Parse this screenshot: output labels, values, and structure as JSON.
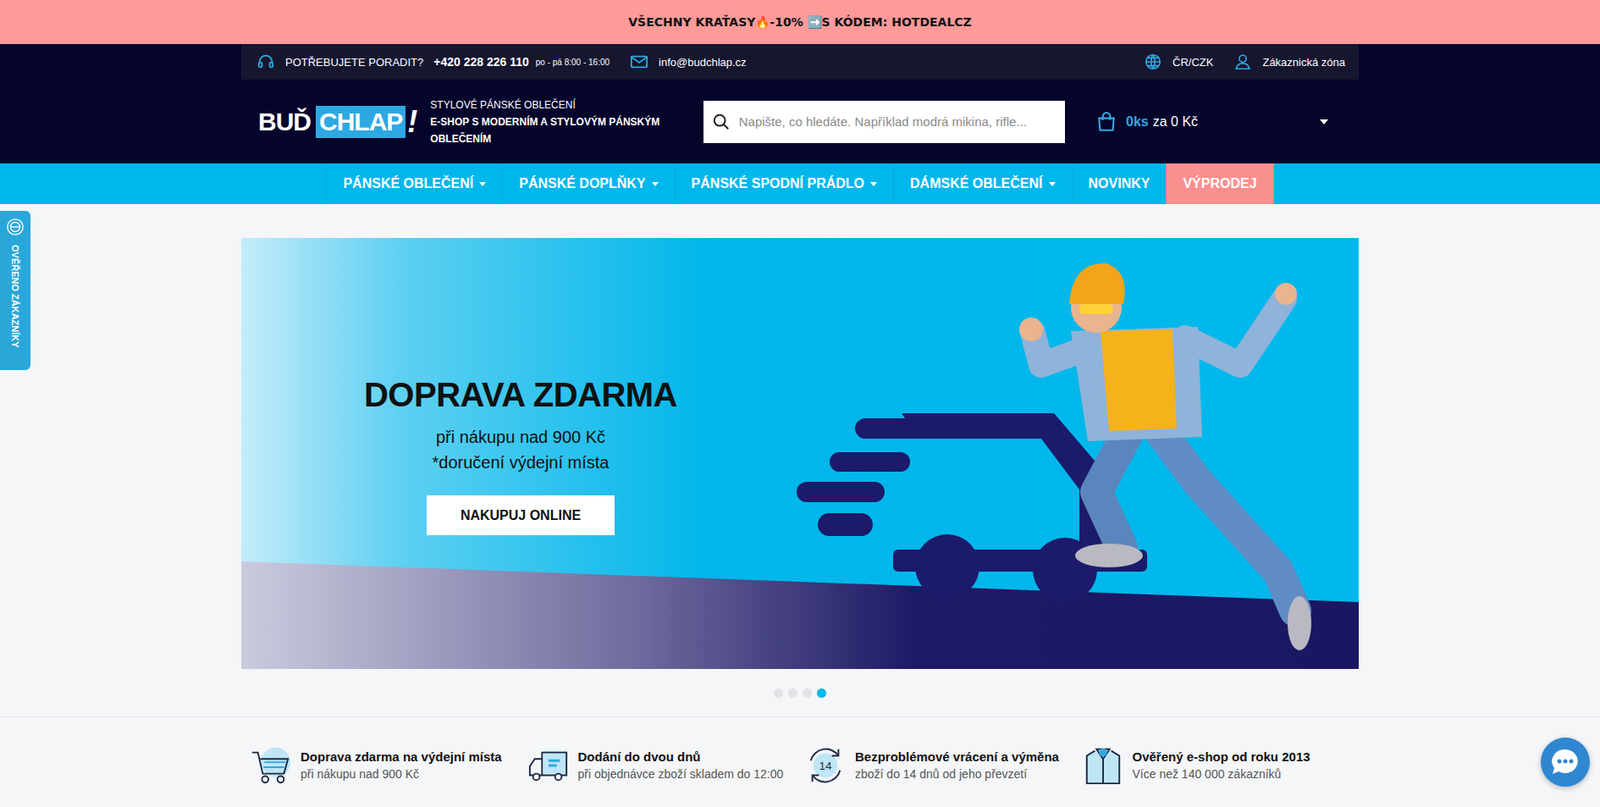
{
  "promo_bar": {
    "text": "VŠECHNY KRAŤASY🔥-10% ➡️S KÓDEM: HOTDEALCZ"
  },
  "top_bar": {
    "help_label": "POTŘEBUJETE PORADIT?",
    "phone": "+420 228 226 110",
    "hours": "po - pá 8:00 - 16:00",
    "email": "info@budchlap.cz",
    "region": "ČR/CZK",
    "account": "Zákaznická zóna"
  },
  "header": {
    "logo": [
      "BUĎ",
      "CHLAP",
      "!"
    ],
    "tagline": [
      "STYLOVÉ PÁNSKÉ OBLEČENÍ",
      "E-SHOP S MODERNÍM A STYLOVÝM PÁNSKÝM OBLEČENÍM"
    ],
    "search": {
      "placeholder": "Napište, co hledáte. Například modrá mikina, rifle..."
    },
    "cart": {
      "count": "0ks",
      "total": "za 0 Kč"
    }
  },
  "nav": [
    {
      "label": "PÁNSKÉ OBLEČENÍ",
      "kind": "dropdown"
    },
    {
      "label": "PÁNSKÉ DOPLŇKY",
      "kind": "dropdown"
    },
    {
      "label": "PÁNSKÉ SPODNÍ PRÁDLO",
      "kind": "dropdown"
    },
    {
      "label": "DÁMSKÉ OBLEČENÍ",
      "kind": "dropdown"
    },
    {
      "label": "NOVINKY",
      "kind": "link"
    },
    {
      "label": "VÝPRODEJ",
      "kind": "sale"
    }
  ],
  "banner": {
    "title": "DOPRAVA ZDARMA",
    "lines": [
      "při nákupu nad 900 Kč",
      "*doručení výdejní místa"
    ],
    "button": "NAKUPUJ ONLINE"
  },
  "carousel_dots": [
    {
      "selected": false
    },
    {
      "selected": false
    },
    {
      "selected": false
    },
    {
      "selected": true
    }
  ],
  "features": [
    {
      "kind": "cart",
      "title": "Doprava zdarma na výdejní místa",
      "subtitle": "při nákupu nad 900 Kč"
    },
    {
      "kind": "truck",
      "title": "Dodání do dvou dnů",
      "subtitle": "při objednávce zboží skladem do 12:00"
    },
    {
      "kind": "return",
      "title": "Bezproblémové vrácení a výměna",
      "subtitle": "zboží do 14 dnů od jeho převzetí",
      "icon_text": "14"
    },
    {
      "kind": "verified",
      "title": "Ověřený e-shop od roku 2013",
      "subtitle": "Více než 140 000 zákazníků"
    }
  ],
  "side_tab": {
    "label": "OVĚŘENO ZÁKAZNÍKY"
  }
}
